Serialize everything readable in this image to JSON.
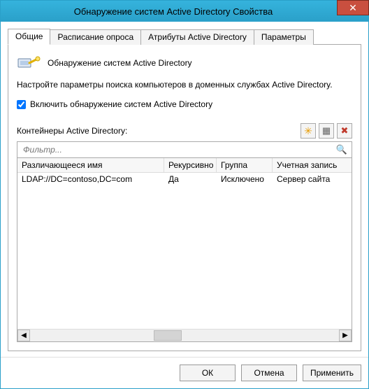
{
  "window": {
    "title": "Обнаружение систем Active Directory Свойства"
  },
  "tabs": [
    {
      "label": "Общие"
    },
    {
      "label": "Расписание опроса"
    },
    {
      "label": "Атрибуты Active Directory"
    },
    {
      "label": "Параметры"
    }
  ],
  "header": {
    "title": "Обнаружение систем Active Directory"
  },
  "description": "Настройте параметры поиска компьютеров в доменных службах Active Directory.",
  "enable": {
    "label": "Включить обнаружение систем Active Directory",
    "checked": true
  },
  "containers": {
    "label": "Контейнеры Active Directory:"
  },
  "filter": {
    "placeholder": "Фильтр..."
  },
  "grid": {
    "columns": {
      "dn": "Различающееся имя",
      "recursive": "Рекурсивно",
      "group": "Группа",
      "account": "Учетная запись"
    },
    "rows": [
      {
        "dn": "LDAP://DC=contoso,DC=com",
        "recursive": "Да",
        "group": "Исключено",
        "account": "Сервер сайта"
      }
    ]
  },
  "buttons": {
    "ok": "ОК",
    "cancel": "Отмена",
    "apply": "Применить"
  },
  "icons": {
    "close": "✕",
    "new": "✳",
    "edit": "▦",
    "delete": "✖",
    "search": "🔍",
    "left": "◀",
    "right": "▶",
    "thumb": "⋮⋮"
  }
}
